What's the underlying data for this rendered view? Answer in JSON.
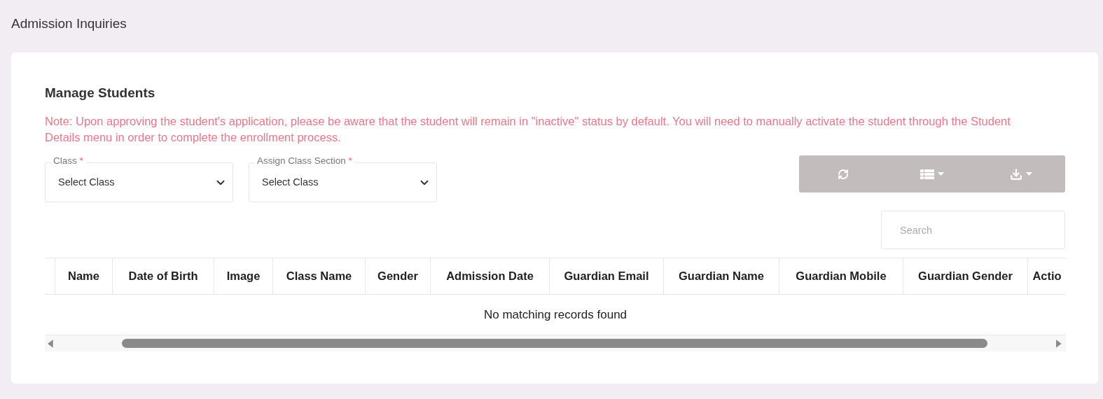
{
  "page_title": "Admission Inquiries",
  "card": {
    "title": "Manage Students",
    "note": "Note: Upon approving the student's application, please be aware that the student will remain in \"inactive\" status by default. You will need to manually activate the student through the Student Details menu in order to complete the enrollment process.",
    "filters": [
      {
        "label": "Class",
        "required_mark": "*",
        "value": "Select Class"
      },
      {
        "label": "Assign Class Section",
        "required_mark": "*",
        "value": "Select Class"
      }
    ],
    "search": {
      "placeholder": "Search"
    },
    "table": {
      "columns": [
        "Name",
        "Date of Birth",
        "Image",
        "Class Name",
        "Gender",
        "Admission Date",
        "Guardian Email",
        "Guardian Name",
        "Guardian Mobile",
        "Guardian Gender",
        "Actio"
      ],
      "empty_message": "No matching records found"
    }
  }
}
